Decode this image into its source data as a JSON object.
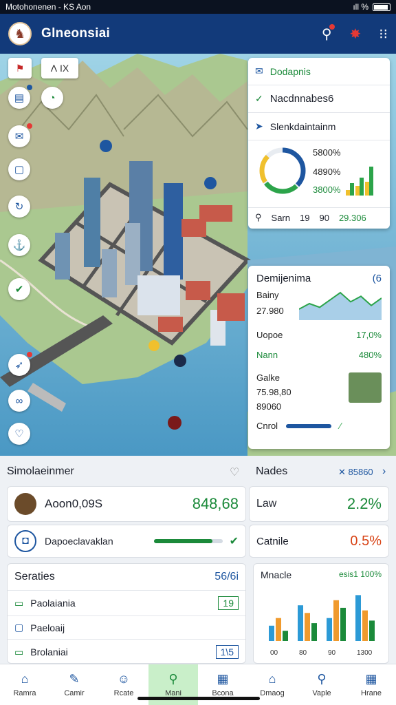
{
  "status": {
    "left": "Motohonenen - KS Aon",
    "right": "ıll %"
  },
  "app": {
    "title": "Glneonsiai",
    "logo": "lion-crest-logo",
    "icons": [
      "person-pin-icon",
      "alert-icon",
      "grid-icon"
    ]
  },
  "map": {
    "top_tools": [
      {
        "label": "",
        "icon": "flag-icon"
      },
      {
        "label": "Ʌ  IX",
        "icon": "tool-icon"
      }
    ],
    "left_tools": [
      "card-icon",
      "compass-icon",
      "mail-icon",
      "document-icon",
      "refresh-icon",
      "anchor-icon",
      "check-shield-icon",
      "route-icon",
      "link-icon",
      "heart-icon"
    ],
    "card1": {
      "row1": "Dodapnis",
      "row2": "Nacdnnabes6",
      "row3": "Slenkdaintainm",
      "donut_values": [
        "5800%",
        "4890%",
        "3800%"
      ],
      "footer": {
        "label": "Sarn",
        "a": "19",
        "b": "90",
        "c": "29.306"
      }
    },
    "card2": {
      "title": "Demijenima",
      "badge": "(6",
      "rows": [
        {
          "label": "Bainy",
          "value": "27.980"
        },
        {
          "label": "Uopoe",
          "value": "17,0%"
        },
        {
          "label": "Nann",
          "value": "480%"
        }
      ],
      "block": {
        "line1": "Galke",
        "line2": "75.98,80",
        "line3": "89060"
      },
      "footer": "Cnrol"
    },
    "chart_line": [
      12,
      18,
      14,
      22,
      30,
      20,
      26,
      16,
      24
    ],
    "bars": [
      [
        8,
        18
      ],
      [
        14,
        26
      ],
      [
        20,
        42
      ]
    ]
  },
  "left_panel": {
    "header": "Simolaeinmer",
    "item1": {
      "label": "Aoon0,09S",
      "value": "848,68"
    },
    "item2": {
      "label": "Dapoeclavaklan",
      "progress": 0.85
    },
    "table_header": {
      "label": "Seraties",
      "value": "56/6i"
    },
    "rows": [
      {
        "label": "Paolaiania",
        "value": "19"
      },
      {
        "label": "Paeloaij",
        "value": ""
      },
      {
        "label": "Brolaniai",
        "value": "1\\5"
      }
    ]
  },
  "right_panel": {
    "header": "Nades",
    "header_value": "✕ 85860",
    "item1": {
      "label": "Law",
      "value": "2.2%"
    },
    "item2": {
      "label": "Catnile",
      "value": "0.5%"
    },
    "chart": {
      "title": "Mnacle",
      "value": "esis1 100%",
      "xlabels": [
        "00",
        "80",
        "90",
        "1300"
      ]
    }
  },
  "nav": [
    {
      "label": "Ramra",
      "icon": "home-icon"
    },
    {
      "label": "Camir",
      "icon": "edit-icon"
    },
    {
      "label": "Rcate",
      "icon": "people-icon"
    },
    {
      "label": "Mani",
      "icon": "search-icon"
    },
    {
      "label": "Bcona",
      "icon": "chart-icon"
    },
    {
      "label": "Dmaog",
      "icon": "house-icon"
    },
    {
      "label": "Vaple",
      "icon": "search-icon"
    },
    {
      "label": "Hrane",
      "icon": "chart-icon"
    }
  ],
  "chart_data": {
    "type": "bar",
    "title": "Mnacle",
    "categories": [
      "00",
      "80",
      "90",
      "1300"
    ],
    "series": [
      {
        "values": [
          30,
          70,
          45,
          90
        ]
      },
      {
        "values": [
          45,
          55,
          80,
          60
        ]
      },
      {
        "values": [
          20,
          35,
          65,
          40
        ]
      }
    ]
  }
}
